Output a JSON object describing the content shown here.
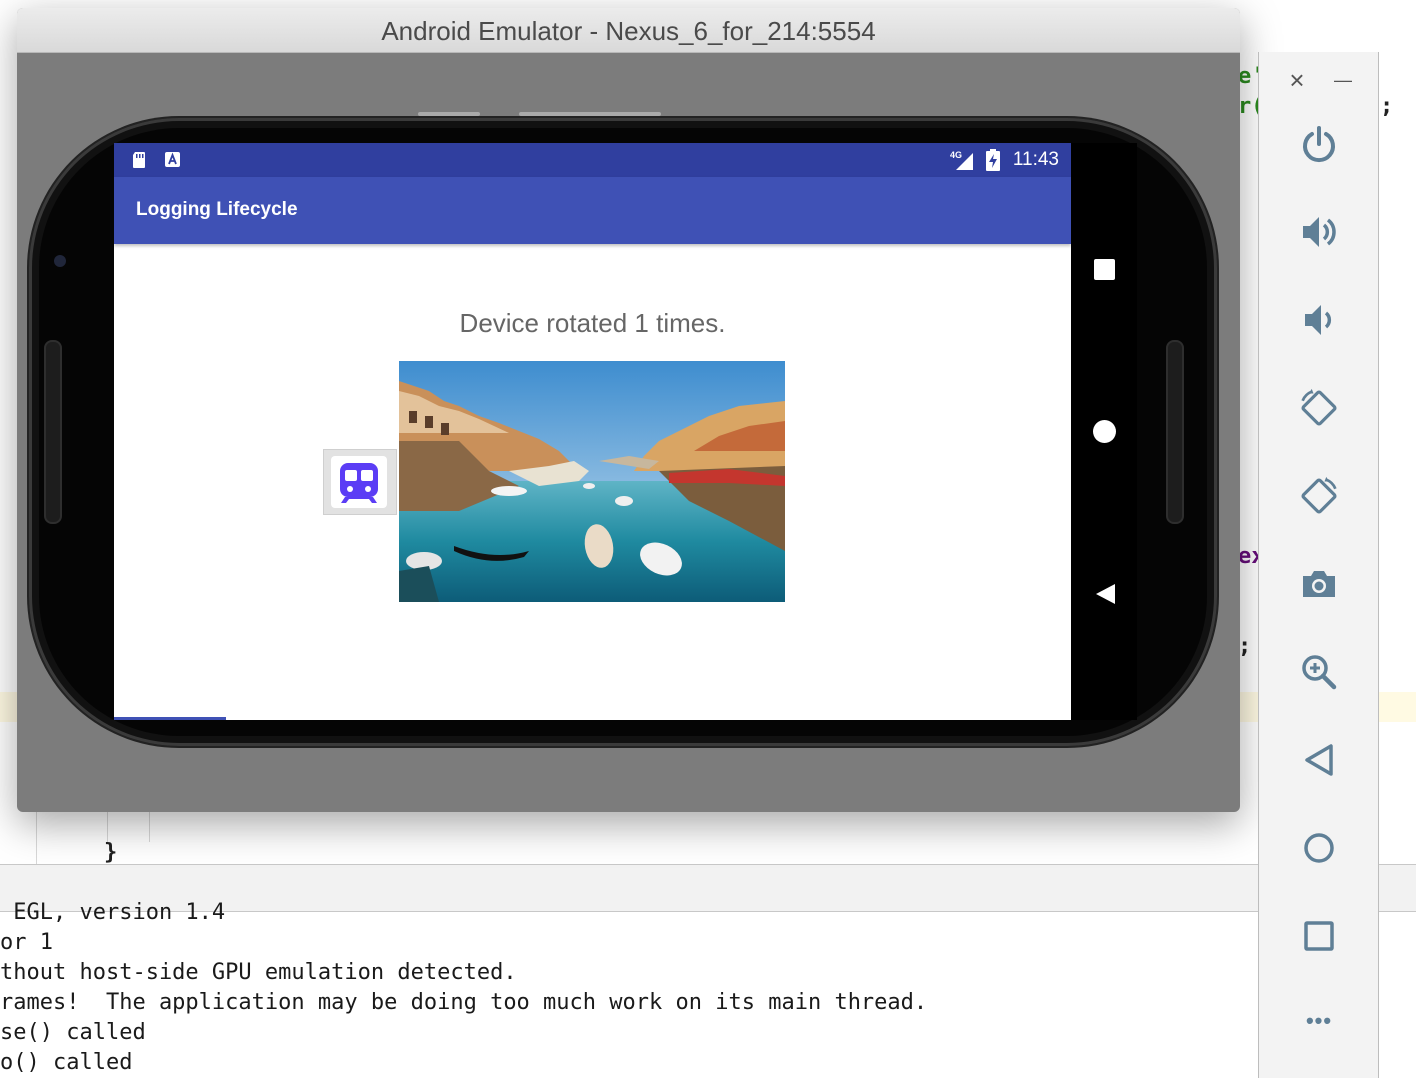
{
  "emulator": {
    "window_title": "Android Emulator - Nexus_6_for_214:5554"
  },
  "device": {
    "status_bar": {
      "time": "11:43",
      "network": "4G"
    },
    "app_bar": {
      "title": "Logging Lifecycle"
    },
    "content": {
      "message": "Device rotated 1 times."
    }
  },
  "console": {
    "lines": [
      " EGL, version 1.4",
      "or 1",
      "thout host-side GPU emulation detected.",
      "rames!  The application may be doing too much work on its main thread.",
      "se() called",
      "o() called"
    ]
  },
  "code_fragments": {
    "f1": "e'",
    "f2": "r(",
    "f3": ";",
    "f4": "ex",
    "f5": ";",
    "f6": "}"
  },
  "toolbar": {
    "close": "×",
    "minimize": "—",
    "more": "•••"
  },
  "colors": {
    "primary": "#3f51b5",
    "primary_dark": "#303f9f",
    "toolbar_icon": "#5f7f96"
  }
}
